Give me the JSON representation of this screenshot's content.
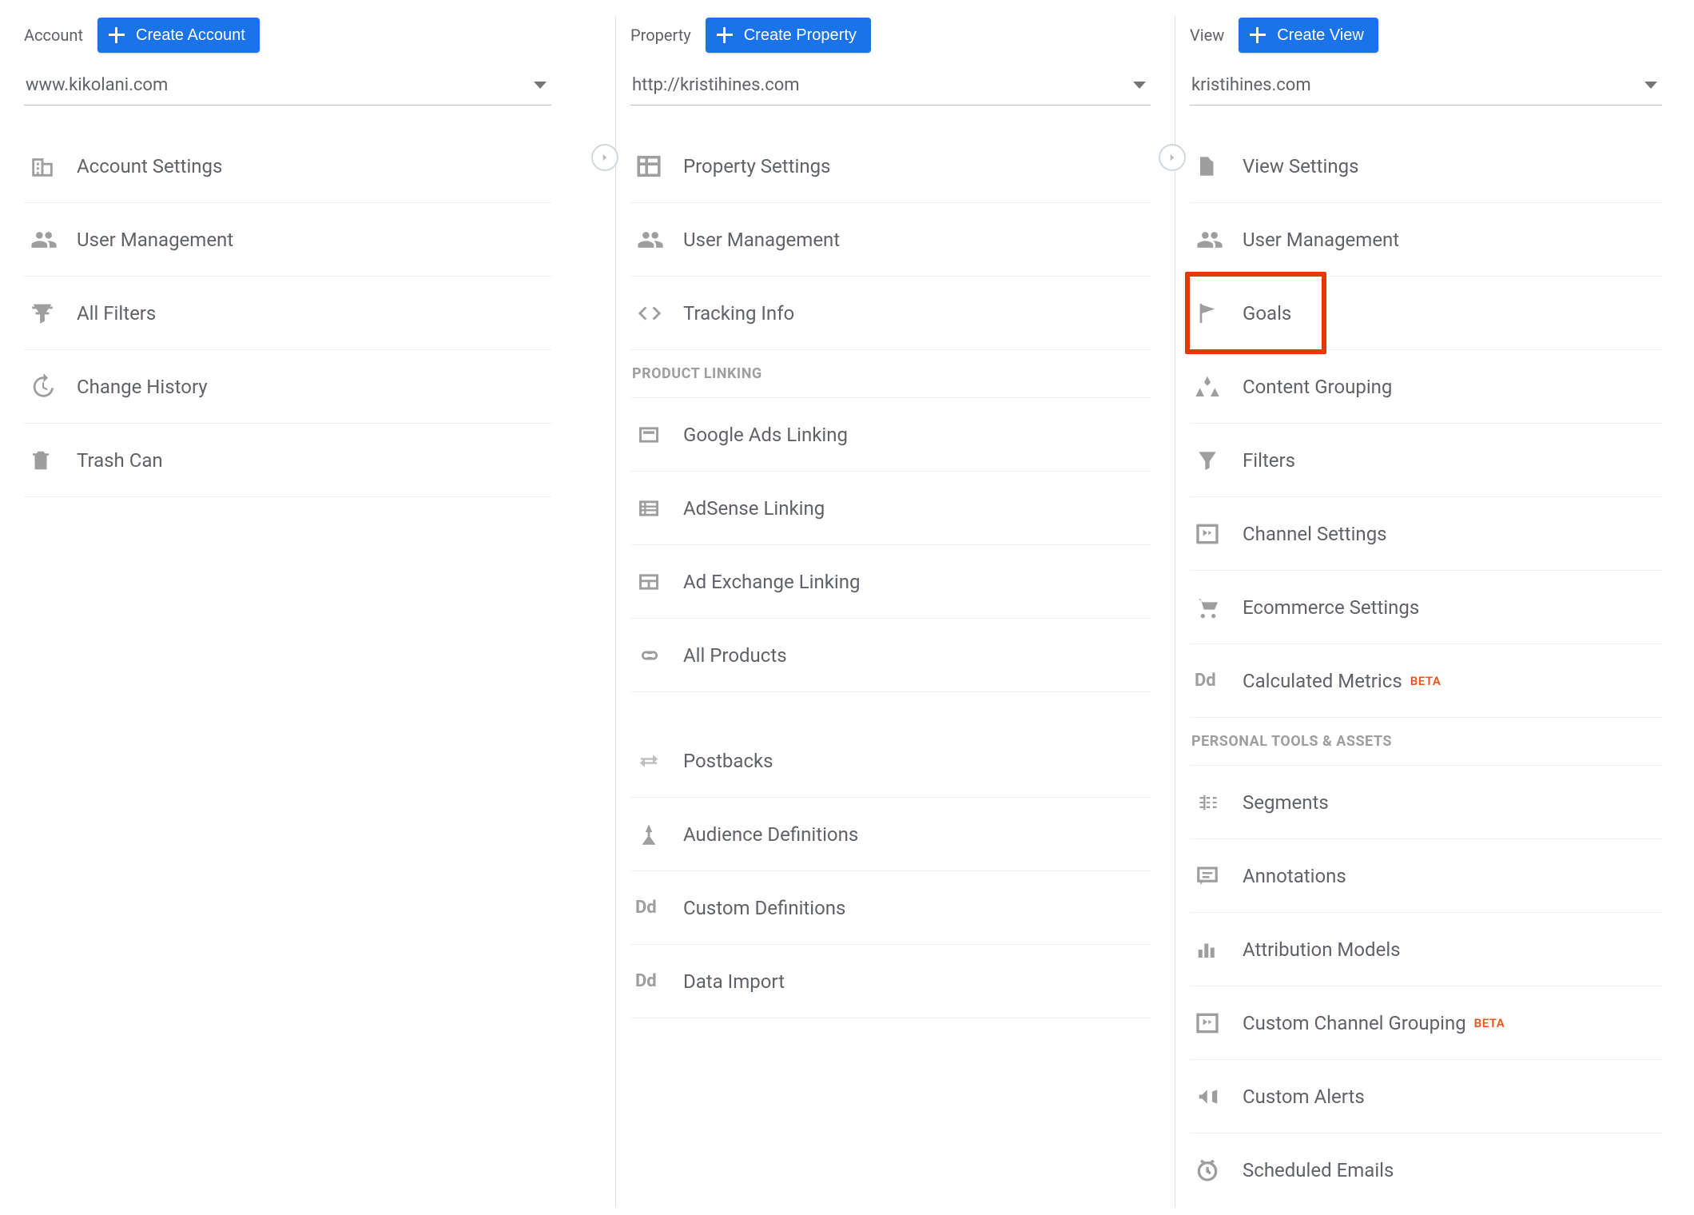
{
  "columns": {
    "account": {
      "title": "Account",
      "create_label": "Create Account",
      "selector_value": "www.kikolani.com",
      "items": [
        {
          "label": "Account Settings"
        },
        {
          "label": "User Management"
        },
        {
          "label": "All Filters"
        },
        {
          "label": "Change History"
        },
        {
          "label": "Trash Can"
        }
      ]
    },
    "property": {
      "title": "Property",
      "create_label": "Create Property",
      "selector_value": "http://kristihines.com",
      "items": [
        {
          "label": "Property Settings"
        },
        {
          "label": "User Management"
        },
        {
          "label": "Tracking Info"
        }
      ],
      "section_product_linking": "PRODUCT LINKING",
      "product_items": [
        {
          "label": "Google Ads Linking"
        },
        {
          "label": "AdSense Linking"
        },
        {
          "label": "Ad Exchange Linking"
        },
        {
          "label": "All Products"
        }
      ],
      "more_items": [
        {
          "label": "Postbacks"
        },
        {
          "label": "Audience Definitions"
        },
        {
          "label": "Custom Definitions"
        },
        {
          "label": "Data Import"
        }
      ]
    },
    "view": {
      "title": "View",
      "create_label": "Create View",
      "selector_value": "kristihines.com",
      "items": [
        {
          "label": "View Settings"
        },
        {
          "label": "User Management"
        },
        {
          "label": "Goals",
          "highlight": true
        },
        {
          "label": "Content Grouping"
        },
        {
          "label": "Filters"
        },
        {
          "label": "Channel Settings"
        },
        {
          "label": "Ecommerce Settings"
        },
        {
          "label": "Calculated Metrics",
          "badge": "BETA"
        }
      ],
      "section_personal": "PERSONAL TOOLS & ASSETS",
      "personal_items": [
        {
          "label": "Segments"
        },
        {
          "label": "Annotations"
        },
        {
          "label": "Attribution Models"
        },
        {
          "label": "Custom Channel Grouping",
          "badge": "BETA"
        },
        {
          "label": "Custom Alerts"
        },
        {
          "label": "Scheduled Emails"
        }
      ]
    }
  }
}
